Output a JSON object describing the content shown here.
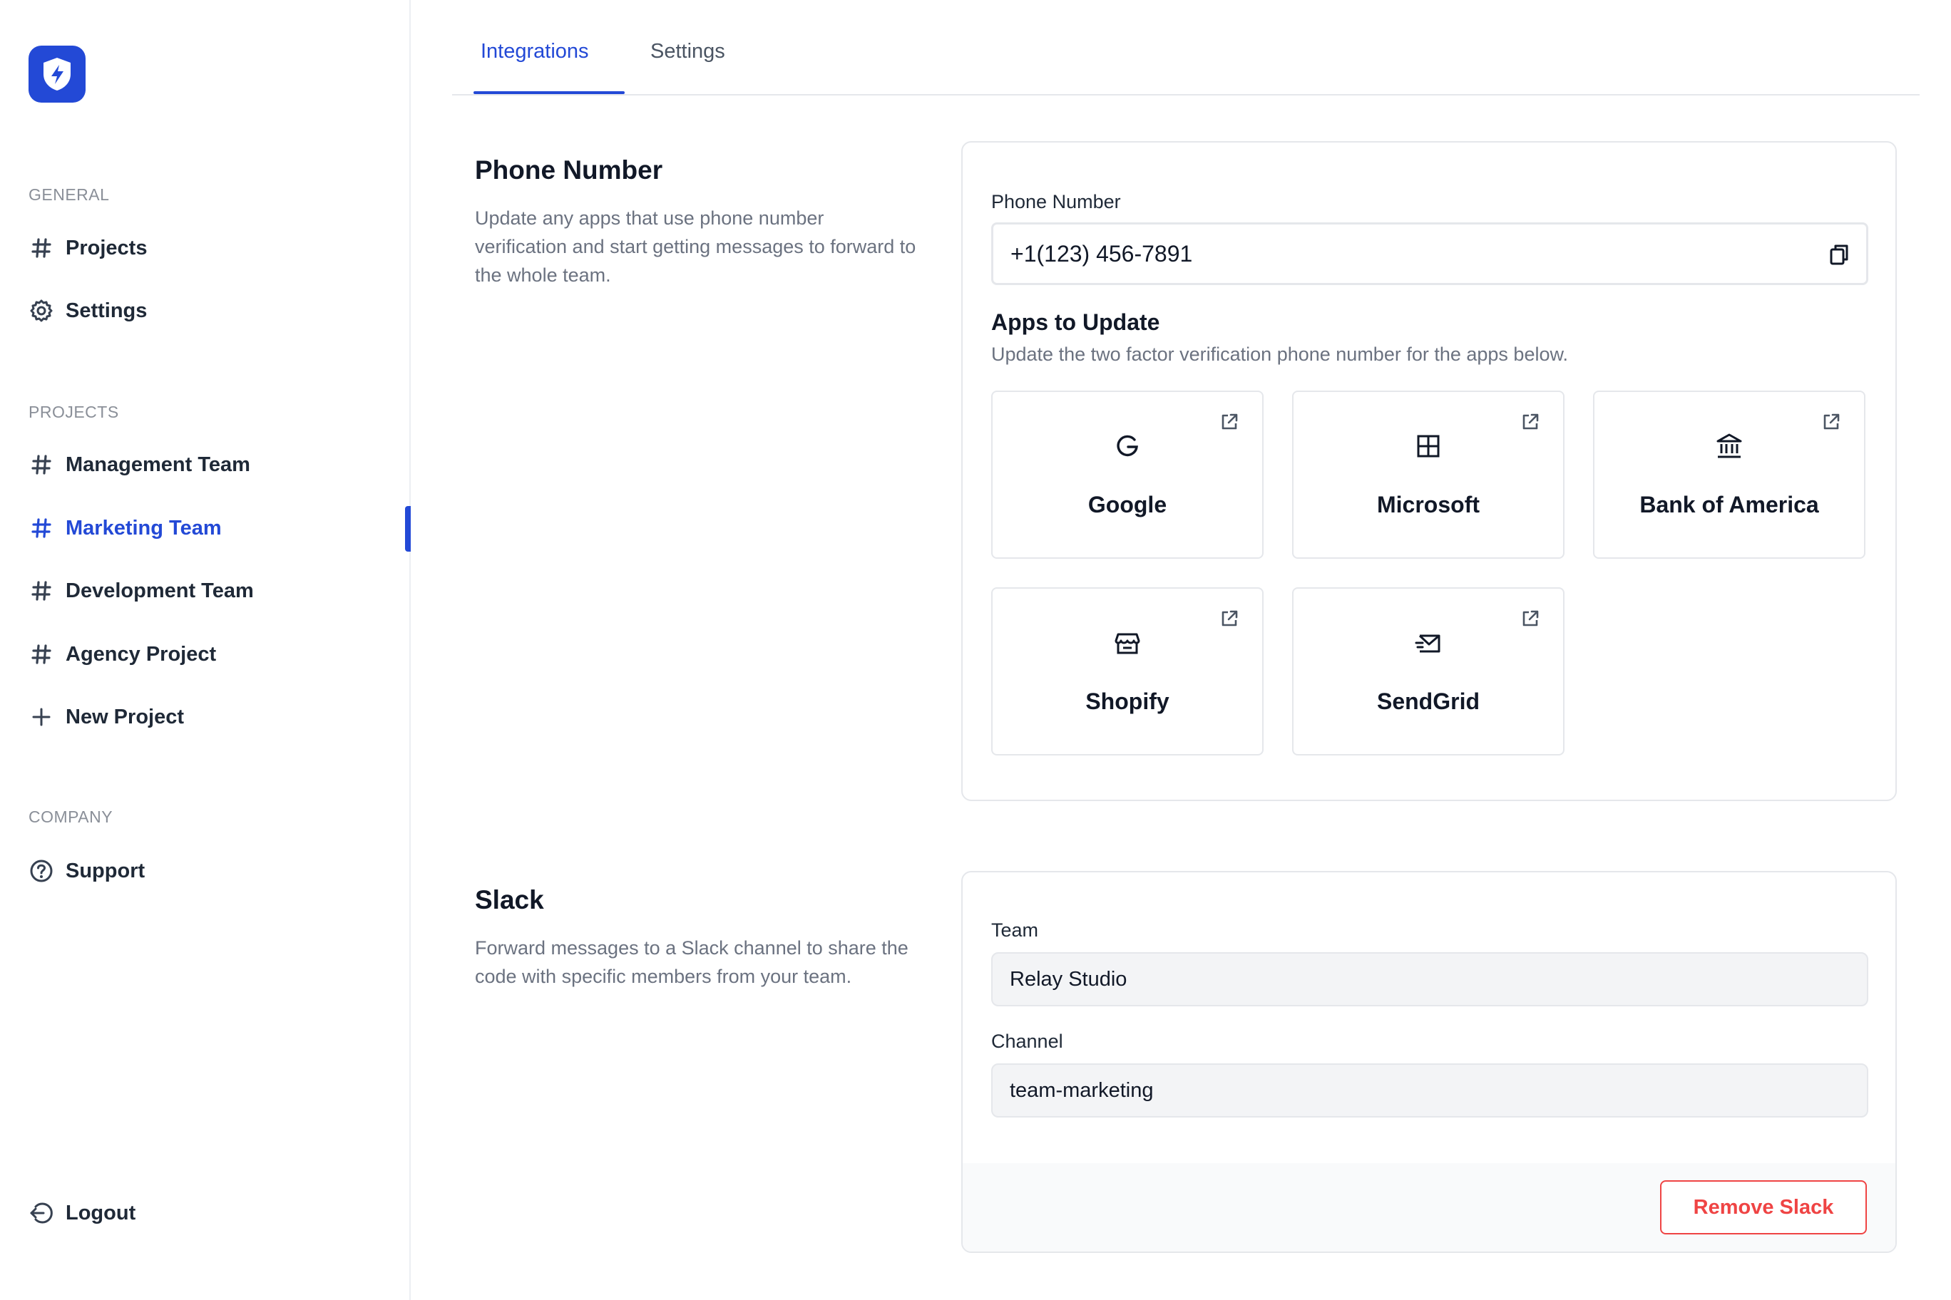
{
  "sidebar": {
    "logo_icon": "shield-bolt-icon",
    "sections": {
      "general": "GENERAL",
      "projects": "PROJECTS",
      "company": "COMPANY"
    },
    "general_items": [
      {
        "label": "Projects",
        "icon": "hash-icon"
      },
      {
        "label": "Settings",
        "icon": "gear-icon"
      }
    ],
    "project_items": [
      {
        "label": "Management Team",
        "icon": "hash-icon"
      },
      {
        "label": "Marketing Team",
        "icon": "hash-icon",
        "active": true
      },
      {
        "label": "Development Team",
        "icon": "hash-icon"
      },
      {
        "label": "Agency Project",
        "icon": "hash-icon"
      },
      {
        "label": "New Project",
        "icon": "plus-icon"
      }
    ],
    "company_items": [
      {
        "label": "Support",
        "icon": "help-circle-icon"
      }
    ],
    "logout_label": "Logout"
  },
  "tabs": [
    {
      "label": "Integrations",
      "active": true
    },
    {
      "label": "Settings",
      "active": false
    }
  ],
  "phone_section": {
    "title": "Phone Number",
    "description": "Update any apps that use phone number verification and start getting messages to forward to the whole team.",
    "field_label": "Phone Number",
    "phone_value": "+1(123) 456-7891",
    "apps_title": "Apps to Update",
    "apps_subtitle": "Update the two factor verification phone number for the apps below.",
    "apps": [
      {
        "name": "Google",
        "icon": "google-g-icon"
      },
      {
        "name": "Microsoft",
        "icon": "windows-grid-icon"
      },
      {
        "name": "Bank of America",
        "icon": "bank-icon"
      },
      {
        "name": "Shopify",
        "icon": "store-icon"
      },
      {
        "name": "SendGrid",
        "icon": "mail-send-icon"
      }
    ]
  },
  "slack_section": {
    "title": "Slack",
    "description": "Forward messages to a Slack channel to share the code with specific members from your team.",
    "team_label": "Team",
    "team_value": "Relay Studio",
    "channel_label": "Channel",
    "channel_value": "team-marketing",
    "remove_label": "Remove Slack"
  },
  "colors": {
    "accent": "#2349d6",
    "danger": "#ef4444",
    "border": "#e5e7eb"
  }
}
